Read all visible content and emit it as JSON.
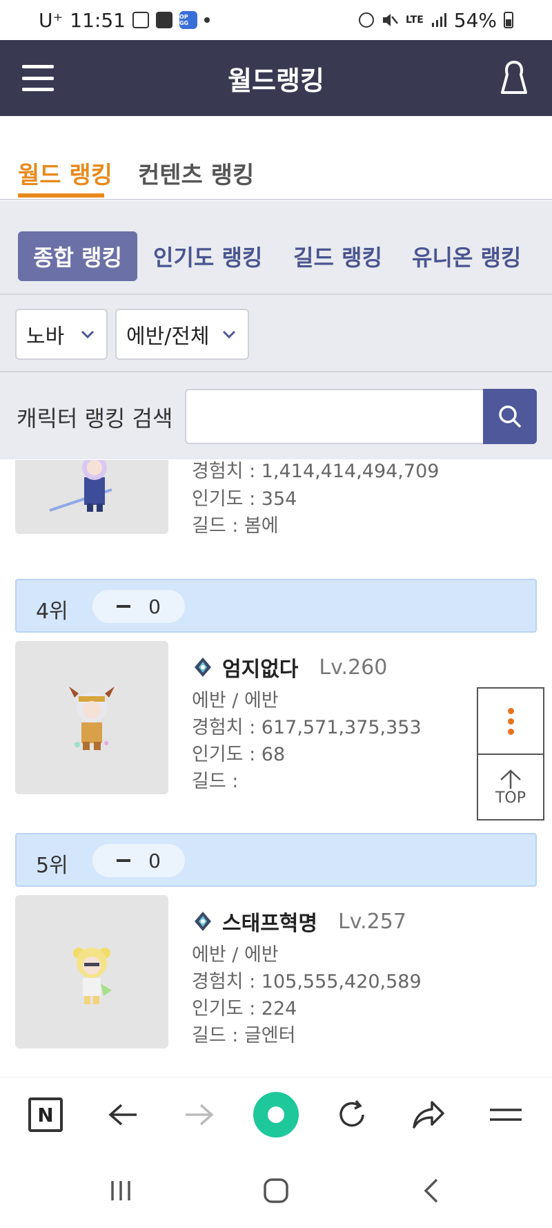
{
  "status_bar": {
    "carrier": "U⁺",
    "time": "11:51",
    "opgg_label": "OP GG",
    "network": "LTE",
    "battery": "54%"
  },
  "header": {
    "title": "월드랭킹"
  },
  "main_tabs": [
    {
      "label": "월드 랭킹",
      "active": true
    },
    {
      "label": "컨텐츠 랭킹",
      "active": false
    }
  ],
  "sub_tabs": [
    {
      "label": "종합 랭킹",
      "active": true
    },
    {
      "label": "인기도 랭킹",
      "active": false
    },
    {
      "label": "길드 랭킹",
      "active": false
    },
    {
      "label": "유니온 랭킹",
      "active": false
    }
  ],
  "filters": {
    "world": "노바",
    "job": "에반/전체"
  },
  "search": {
    "label": "캐릭터 랭킹 검색",
    "value": "",
    "placeholder": ""
  },
  "partial_entry": {
    "exp": "경험치 : 1,414,414,494,709",
    "fame": "인기도 : 354",
    "guild": "길드 : 봄에"
  },
  "entries": [
    {
      "rank": "4위",
      "change": "0",
      "name": "엄지없다",
      "level": "Lv.260",
      "job": "에반 / 에반",
      "exp": "경험치 : 617,571,375,353",
      "fame": "인기도 : 68",
      "guild": "길드 :"
    },
    {
      "rank": "5위",
      "change": "0",
      "name": "스태프혁명",
      "level": "Lv.257",
      "job": "에반 / 에반",
      "exp": "경험치 : 105,555,420,589",
      "fame": "인기도 : 224",
      "guild": "길드 : 글엔터"
    }
  ],
  "floating": {
    "top_label": "TOP"
  },
  "browser_bar": {
    "naver_label": "N"
  },
  "colors": {
    "header_bg": "#393a52",
    "accent_orange": "#e88a1c",
    "sub_tab_active": "#6b70a6",
    "search_button": "#4e589a",
    "rank_bar": "#d4e6fb",
    "green_button": "#1ec89a"
  }
}
